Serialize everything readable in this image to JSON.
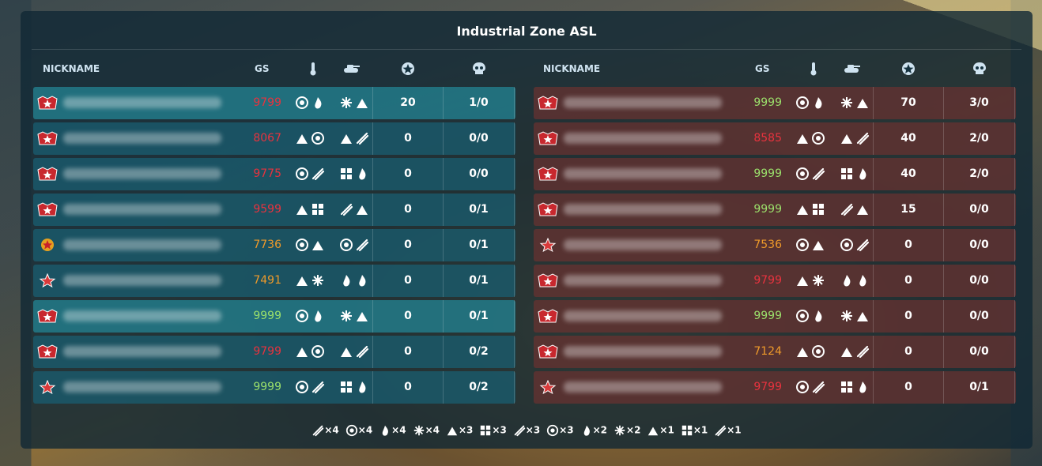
{
  "title": "Industrial Zone ASL",
  "columns": {
    "nickname": "NICKNAME",
    "gs": "GS"
  },
  "column_icons": [
    "thermometer-icon",
    "tank-icon",
    "star-icon",
    "skull-icon"
  ],
  "colors": {
    "gs_red": "#e8323e",
    "gs_orange": "#ef9a2a",
    "gs_gradient": "#9be06b",
    "team_blue": "#1e5f73",
    "team_red": "#693230"
  },
  "blue_team": [
    {
      "gs": "9799",
      "gs_color": "red",
      "score": "20",
      "kd": "1/0",
      "rank": "rank-generalissimo-icon"
    },
    {
      "gs": "8067",
      "gs_color": "red",
      "score": "0",
      "kd": "0/0",
      "rank": "rank-generalissimo-icon"
    },
    {
      "gs": "9775",
      "gs_color": "red",
      "score": "0",
      "kd": "0/0",
      "rank": "rank-generalissimo-icon"
    },
    {
      "gs": "9599",
      "gs_color": "red",
      "score": "0",
      "kd": "0/1",
      "rank": "rank-generalissimo-icon"
    },
    {
      "gs": "7736",
      "gs_color": "orange",
      "score": "0",
      "kd": "0/1",
      "rank": "rank-marshal-icon"
    },
    {
      "gs": "7491",
      "gs_color": "orange",
      "score": "0",
      "kd": "0/1",
      "rank": "rank-star-icon"
    },
    {
      "gs": "9999",
      "gs_color": "gradient",
      "score": "0",
      "kd": "0/1",
      "rank": "rank-generalissimo-icon"
    },
    {
      "gs": "9799",
      "gs_color": "red",
      "score": "0",
      "kd": "0/2",
      "rank": "rank-generalissimo-icon"
    },
    {
      "gs": "9999",
      "gs_color": "gradient",
      "score": "0",
      "kd": "0/2",
      "rank": "rank-star-icon"
    }
  ],
  "red_team": [
    {
      "gs": "9999",
      "gs_color": "gradient",
      "score": "70",
      "kd": "3/0",
      "rank": "rank-generalissimo-icon"
    },
    {
      "gs": "8585",
      "gs_color": "red",
      "score": "40",
      "kd": "2/0",
      "rank": "rank-generalissimo-icon"
    },
    {
      "gs": "9999",
      "gs_color": "gradient",
      "score": "40",
      "kd": "2/0",
      "rank": "rank-generalissimo-icon"
    },
    {
      "gs": "9999",
      "gs_color": "gradient",
      "score": "15",
      "kd": "0/0",
      "rank": "rank-generalissimo-icon"
    },
    {
      "gs": "7536",
      "gs_color": "orange",
      "score": "0",
      "kd": "0/0",
      "rank": "rank-star-icon"
    },
    {
      "gs": "9799",
      "gs_color": "red",
      "score": "0",
      "kd": "0/0",
      "rank": "rank-generalissimo-icon"
    },
    {
      "gs": "9999",
      "gs_color": "gradient",
      "score": "0",
      "kd": "0/0",
      "rank": "rank-generalissimo-icon"
    },
    {
      "gs": "7124",
      "gs_color": "orange",
      "score": "0",
      "kd": "0/0",
      "rank": "rank-generalissimo-icon"
    },
    {
      "gs": "9799",
      "gs_color": "red",
      "score": "0",
      "kd": "0/1",
      "rank": "rank-star-icon"
    }
  ],
  "footer_counts": [
    {
      "icon": "sniper-icon",
      "label": "×4"
    },
    {
      "icon": "no-entry-icon",
      "label": "×4"
    },
    {
      "icon": "drops-icon",
      "label": "×4"
    },
    {
      "icon": "comet-icon",
      "label": "×4"
    },
    {
      "icon": "check-icon",
      "label": "×3"
    },
    {
      "icon": "flame-icon",
      "label": "×3"
    },
    {
      "icon": "swoosh-icon",
      "label": "×3"
    },
    {
      "icon": "bolt-arrow-icon",
      "label": "×3"
    },
    {
      "icon": "snowflake-icon",
      "label": "×2"
    },
    {
      "icon": "lightning-icon",
      "label": "×2"
    },
    {
      "icon": "burst-icon",
      "label": "×1"
    },
    {
      "icon": "wind-icon",
      "label": "×1"
    },
    {
      "icon": "target-icon",
      "label": "×1"
    }
  ]
}
